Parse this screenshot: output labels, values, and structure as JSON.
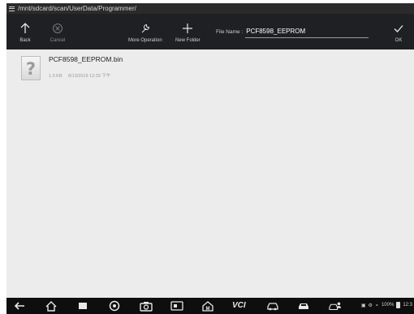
{
  "path": "/mnt/sdcard/scan/UserData/Programmer/",
  "toolbar": {
    "back_label": "Back",
    "cancel_label": "Cancel",
    "more_label": "More Operation",
    "new_folder_label": "New Folder",
    "file_name_label": "File Name :",
    "file_name_value": "PCF8598_EEPROM",
    "ok_label": "OK"
  },
  "files": [
    {
      "name": "PCF8598_EEPROM.bin",
      "size": "1.0 KB",
      "date": "8/13/2019 12:33 下午"
    }
  ],
  "navbar": {
    "vci_label": "VCI",
    "battery": "100%",
    "time": "12:3"
  },
  "colors": {
    "toolbar_bg": "#1f2024",
    "content_bg": "#ececec",
    "navbar_bg": "#0e0e0e"
  }
}
